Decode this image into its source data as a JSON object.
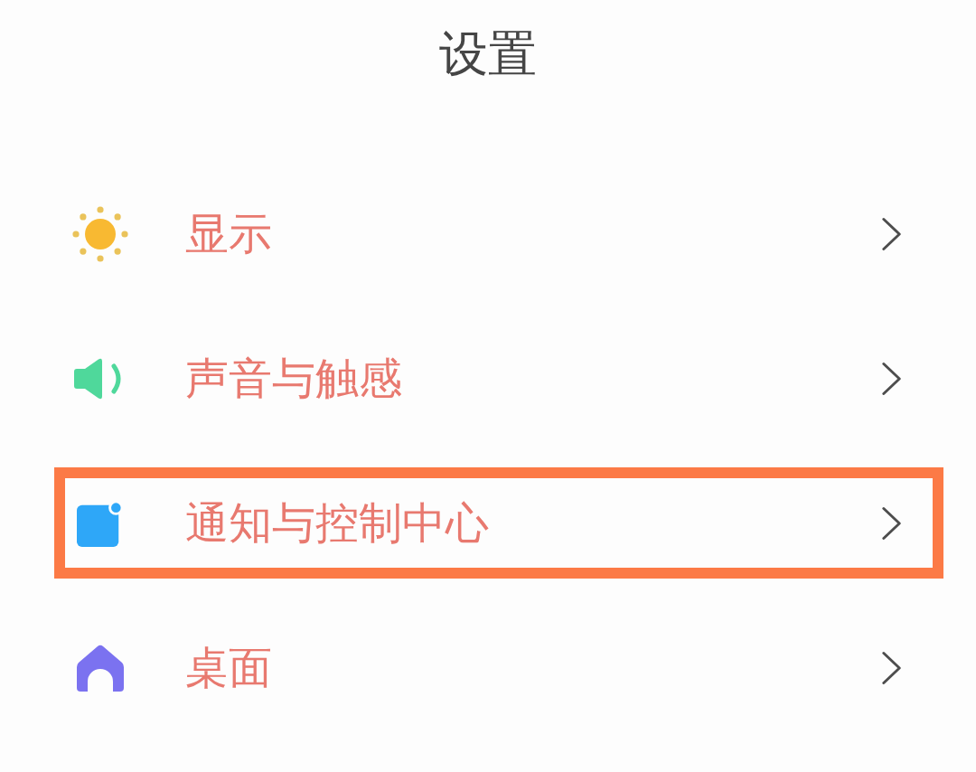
{
  "title": "设置",
  "items": [
    {
      "kind": "sun",
      "label": "显示",
      "highlighted": false
    },
    {
      "kind": "speaker",
      "label": "声音与触感",
      "highlighted": false
    },
    {
      "kind": "notification",
      "label": "通知与控制中心",
      "highlighted": true
    },
    {
      "kind": "home",
      "label": "桌面",
      "highlighted": false
    }
  ]
}
